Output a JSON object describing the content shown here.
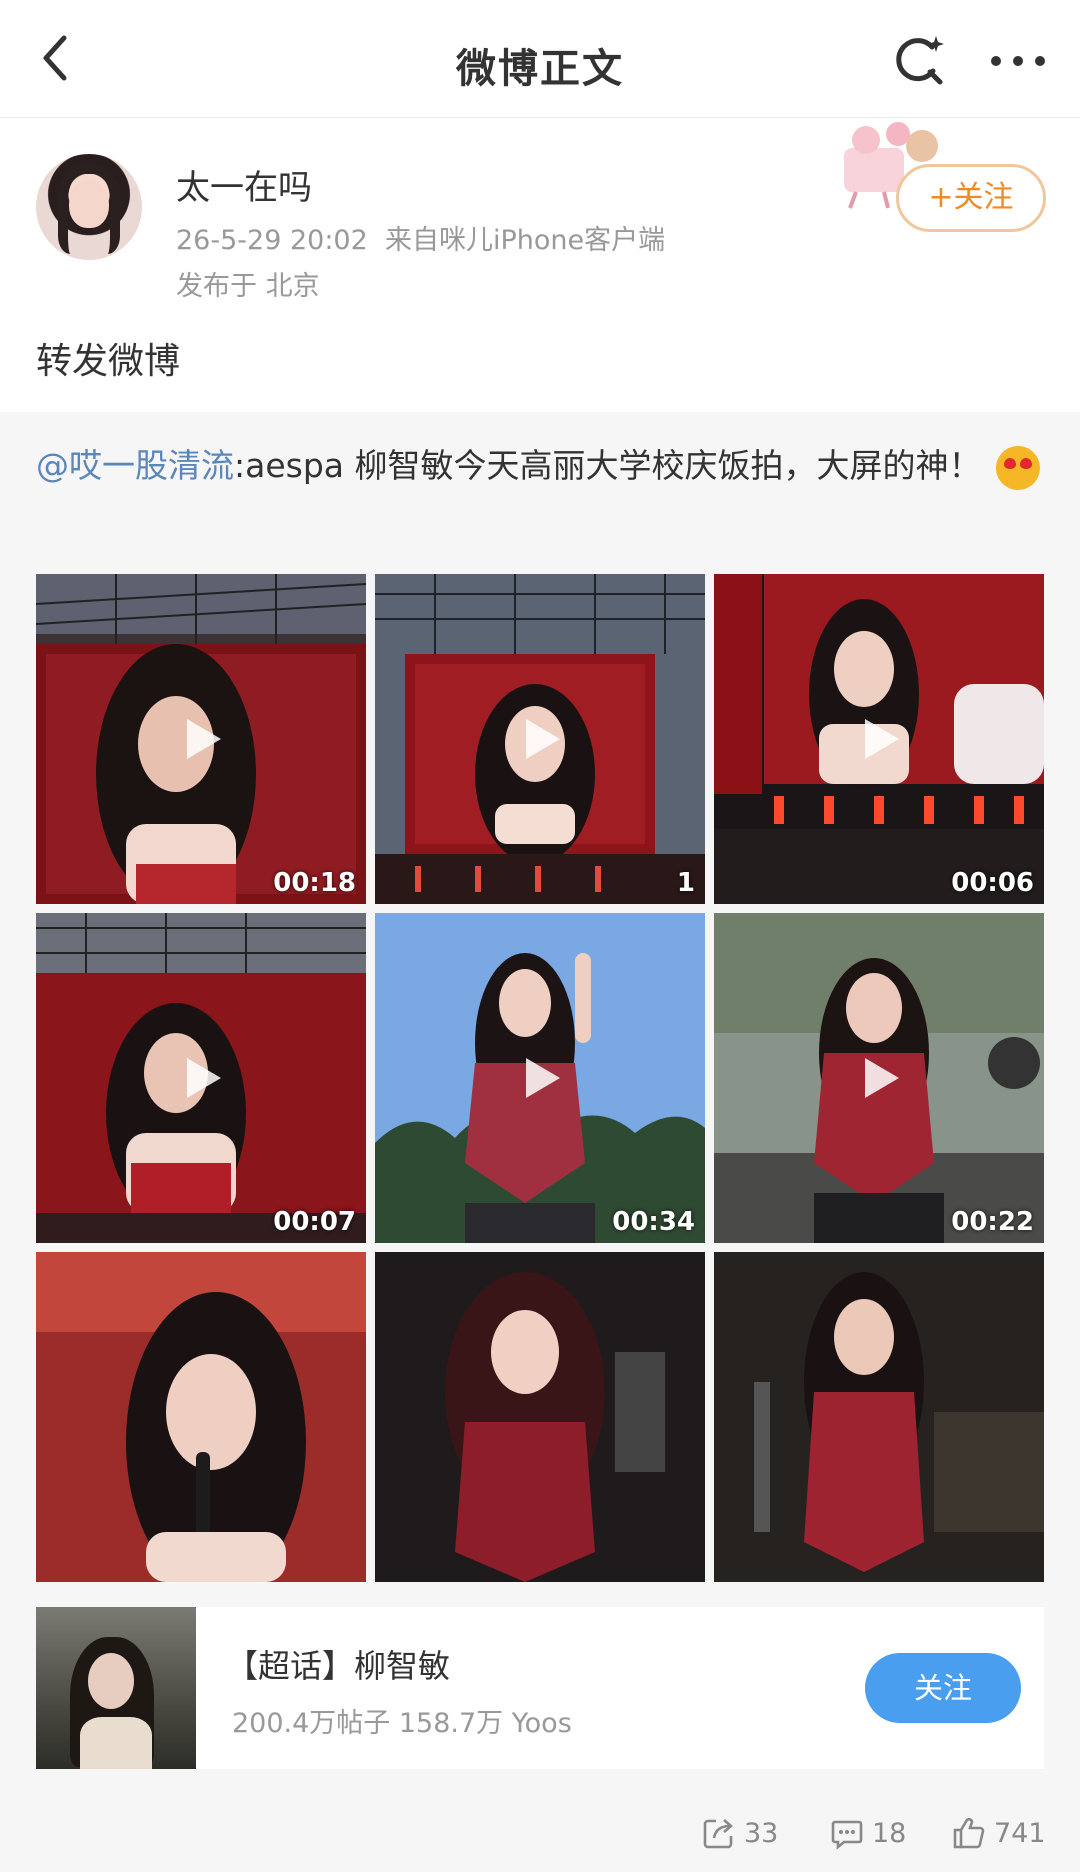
{
  "nav": {
    "title": "微博正文",
    "back_icon": "back-arrow-icon",
    "search_icon": "search-icon",
    "more_icon": "more-icon"
  },
  "author": {
    "name": "太一在吗",
    "time": "26-5-29 20:02",
    "source": "来自咪儿iPhone客户端",
    "location": "发布于 北京",
    "follow_label": "+关注"
  },
  "post": {
    "text": "转发微博"
  },
  "repost": {
    "mention": "@哎一股清流",
    "text": ":aespa 柳智敏今天高丽大学校庆饭拍，大屏的神！",
    "emoji": "heart-eyes-emoji"
  },
  "media": [
    {
      "duration": "00:18"
    },
    {
      "duration": "1"
    },
    {
      "duration": "00:06"
    },
    {
      "duration": "00:07"
    },
    {
      "duration": "00:34"
    },
    {
      "duration": "00:22"
    },
    {
      "duration": ""
    },
    {
      "duration": ""
    },
    {
      "duration": ""
    }
  ],
  "topic": {
    "title": "【超话】柳智敏",
    "stats": "200.4万帖子 158.7万 Yoos",
    "follow_label": "关注"
  },
  "actions": {
    "repost_count": "33",
    "comment_count": "18",
    "like_count": "741"
  },
  "colors": {
    "follow_orange": "#f08a24",
    "link_blue": "#5b86b9",
    "topic_button_blue": "#4a9ef0"
  }
}
